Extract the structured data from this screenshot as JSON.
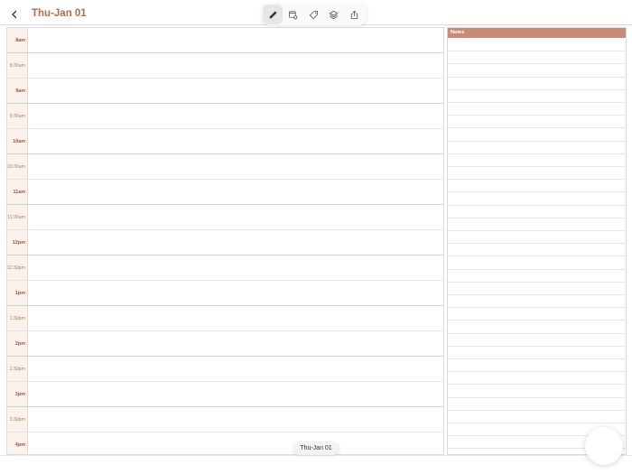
{
  "header": {
    "title": "Thu-Jan 01",
    "back_icon": "chevron-left-icon"
  },
  "toolbar": {
    "tools": [
      {
        "name": "pencil",
        "icon": "pencil-icon",
        "active": true
      },
      {
        "name": "calendar-settings",
        "icon": "calendar-gear-icon",
        "active": false
      },
      {
        "name": "tag",
        "icon": "tag-icon",
        "active": false
      },
      {
        "name": "layers",
        "icon": "layers-icon",
        "active": false
      },
      {
        "name": "share",
        "icon": "share-icon",
        "active": false
      }
    ]
  },
  "schedule": {
    "times": [
      "8am",
      "8:30am",
      "9am",
      "9:30am",
      "10am",
      "10:30am",
      "11am",
      "11:30am",
      "12pm",
      "12:30pm",
      "1pm",
      "1:30pm",
      "2pm",
      "2:30pm",
      "3pm",
      "3:30pm",
      "4pm"
    ]
  },
  "notes": {
    "title": "Notes"
  },
  "footer": {
    "date_label": "Thu-Jan 01"
  },
  "colors": {
    "accent": "#b5694d",
    "notes_header": "#c98b77",
    "time_column": "#fbf1ed"
  }
}
